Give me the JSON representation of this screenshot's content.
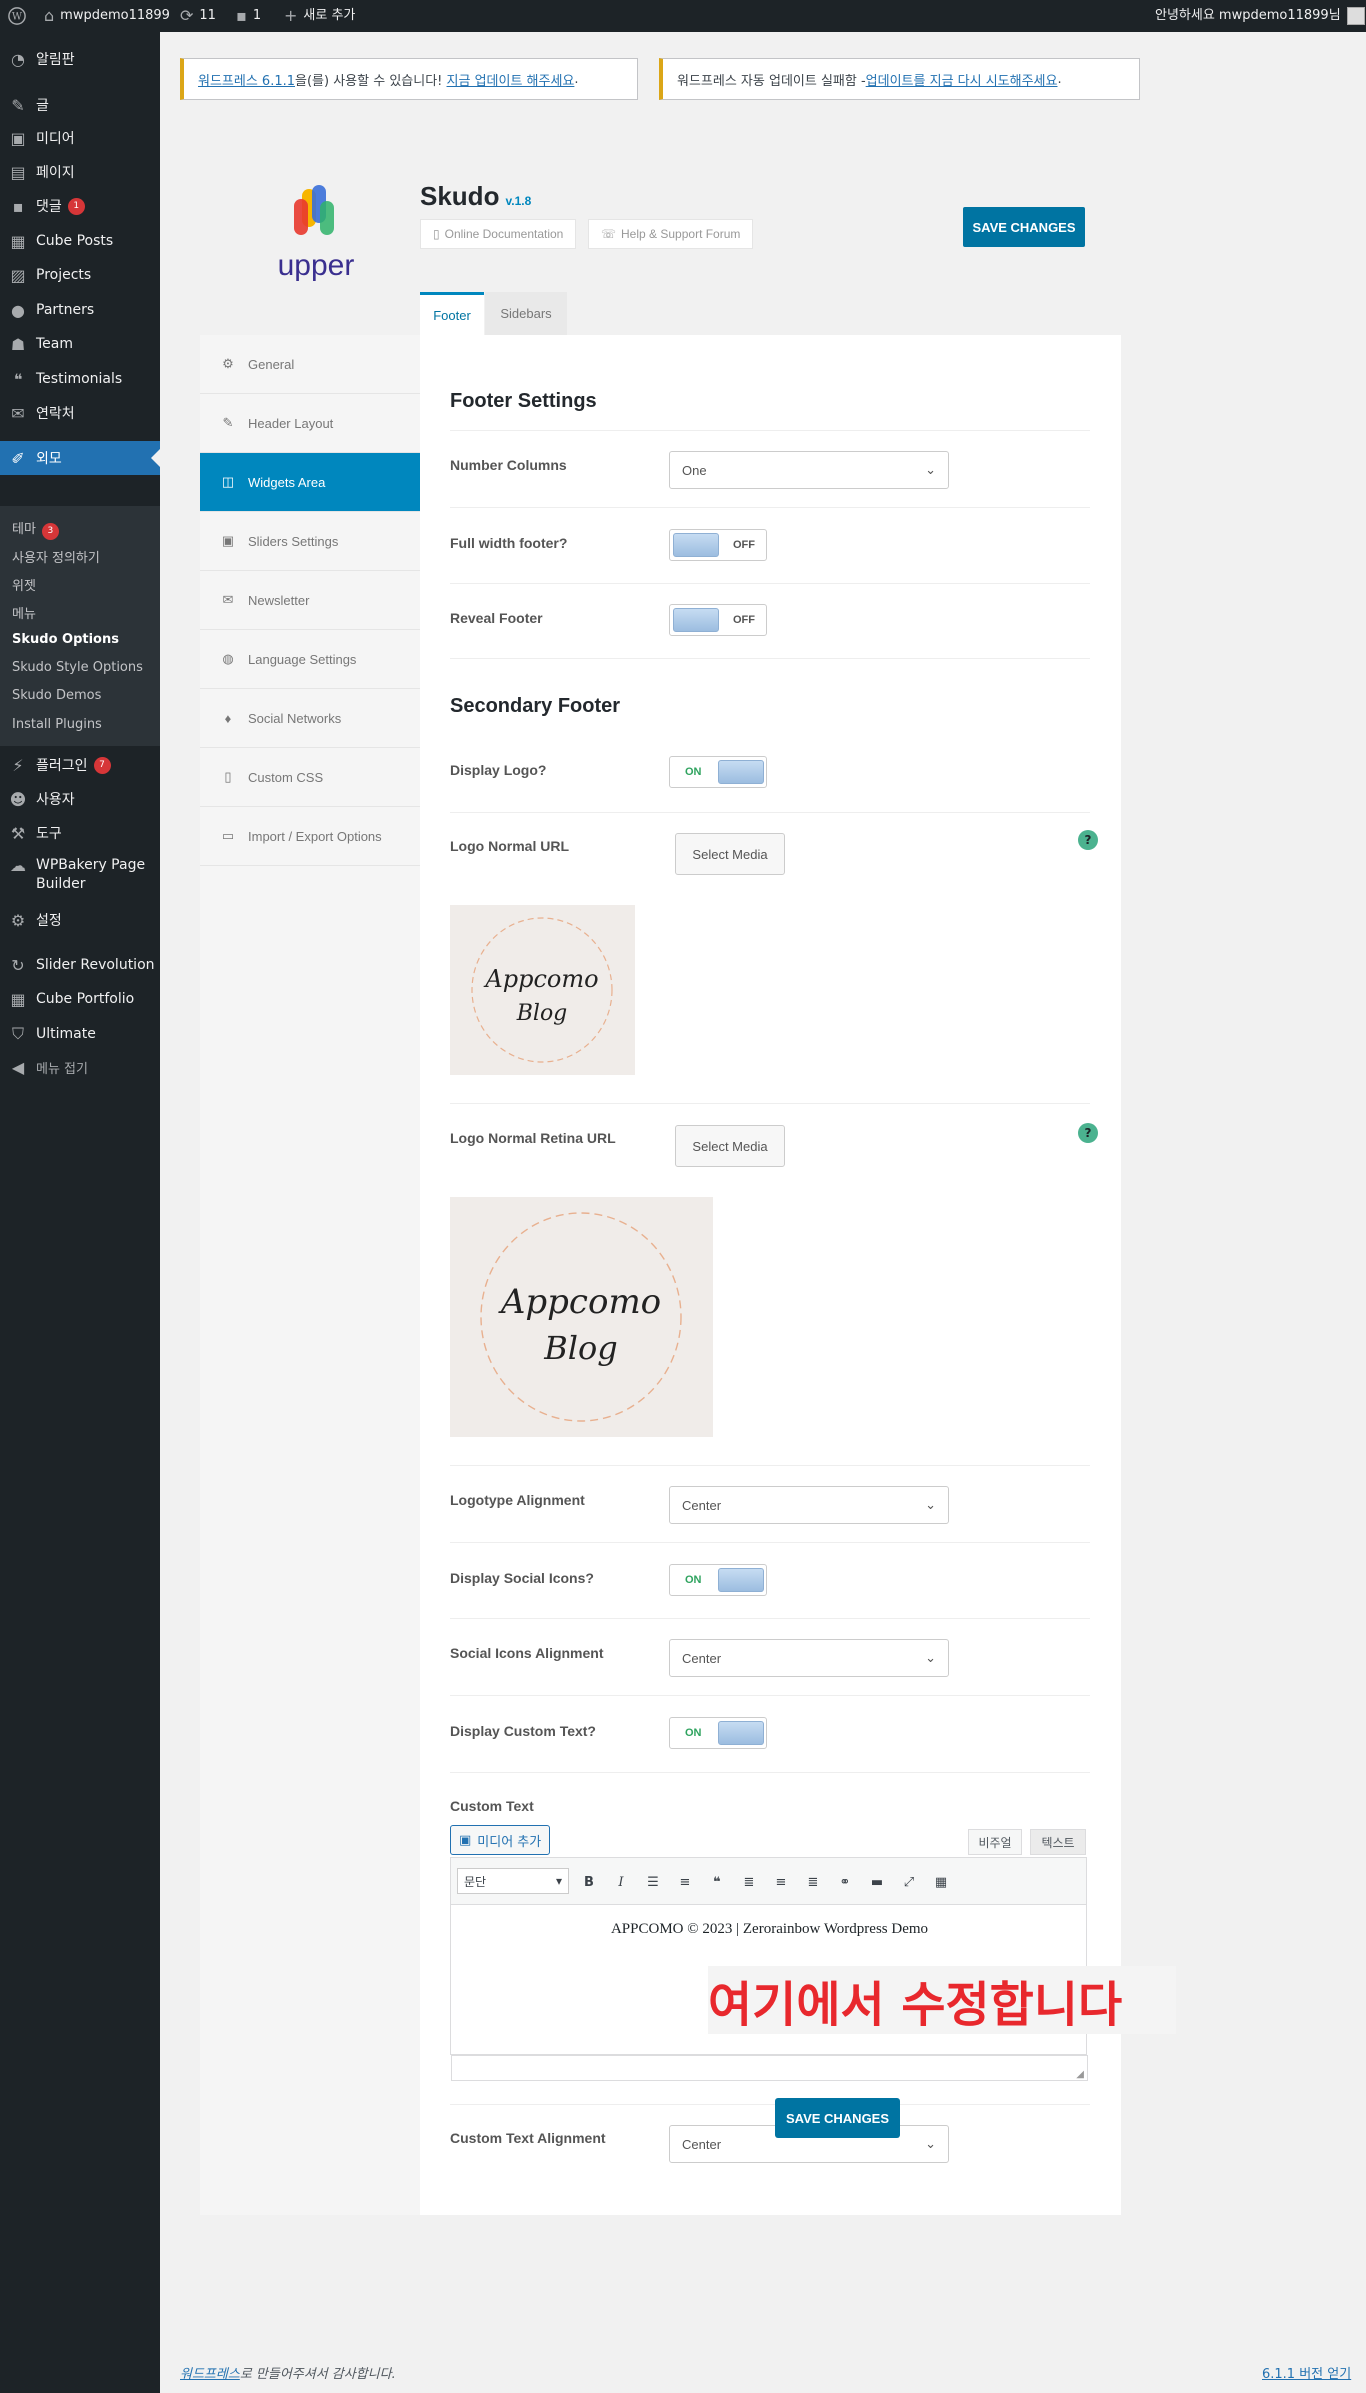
{
  "adminbar": {
    "site_name": "mwpdemo11899",
    "updates_count": "11",
    "comments_count": "1",
    "new_label": "새로 추가",
    "greeting": "안녕하세요 mwpdemo11899님"
  },
  "sidebar": {
    "items": [
      {
        "label": "알림판",
        "icon": "dashboard-icon"
      },
      {
        "label": "글",
        "icon": "pin-icon"
      },
      {
        "label": "미디어",
        "icon": "media-icon"
      },
      {
        "label": "페이지",
        "icon": "page-icon"
      },
      {
        "label": "댓글",
        "icon": "comment-icon",
        "badge": "1"
      },
      {
        "label": "Cube Posts",
        "icon": "cube-icon"
      },
      {
        "label": "Projects",
        "icon": "projects-icon"
      },
      {
        "label": "Partners",
        "icon": "partners-icon"
      },
      {
        "label": "Team",
        "icon": "team-icon"
      },
      {
        "label": "Testimonials",
        "icon": "testimonials-icon"
      },
      {
        "label": "연락처",
        "icon": "mail-icon"
      },
      {
        "label": "외모",
        "icon": "brush-icon"
      }
    ],
    "submenu": [
      {
        "label": "테마",
        "badge": "3"
      },
      {
        "label": "사용자 정의하기"
      },
      {
        "label": "위젯"
      },
      {
        "label": "메뉴"
      },
      {
        "label": "Skudo Options"
      },
      {
        "label": "Skudo Style Options"
      },
      {
        "label": "Skudo Demos"
      },
      {
        "label": "Install Plugins"
      }
    ],
    "lower_items": [
      {
        "label": "플러그인",
        "badge": "7"
      },
      {
        "label": "사용자"
      },
      {
        "label": "도구"
      },
      {
        "label": "WPBakery Page Builder"
      },
      {
        "label": "설정"
      },
      {
        "label": "Slider Revolution"
      },
      {
        "label": "Cube Portfolio"
      },
      {
        "label": "Ultimate"
      },
      {
        "label": "메뉴 접기"
      }
    ]
  },
  "notices": {
    "n1_link": "워드프레스 6.1.1",
    "n1_text": "을(를) 사용할 수 있습니다!",
    "n1_action": "지금 업데이트 해주세요",
    "n2_text": "워드프레스 자동 업데이트 실패함 - ",
    "n2_action": "업데이트를 지금 다시 시도해주세요"
  },
  "panel": {
    "logo_text": "upper",
    "title": "Skudo",
    "version": "v.1.8",
    "doc_label": "Online Documentation",
    "support_label": "Help & Support Forum",
    "save_label": "SAVE CHANGES",
    "tabs": [
      "Footer",
      "Sidebars"
    ],
    "nav": [
      "General",
      "Header Layout",
      "Widgets Area",
      "Sliders Settings",
      "Newsletter",
      "Language Settings",
      "Social Networks",
      "Custom CSS",
      "Import / Export Options"
    ]
  },
  "footer_settings": {
    "section_title": "Footer Settings",
    "number_columns_label": "Number Columns",
    "number_columns_value": "One",
    "full_width_label": "Full width footer?",
    "full_width_state": "OFF",
    "reveal_label": "Reveal Footer",
    "reveal_state": "OFF"
  },
  "secondary_footer": {
    "section_title": "Secondary Footer",
    "display_logo_label": "Display Logo?",
    "display_logo_state": "ON",
    "logo_url_label": "Logo Normal URL",
    "logo_retina_label": "Logo Normal Retina URL",
    "select_media": "Select Media",
    "logo_image_text_1": "Appcomo",
    "logo_image_text_2": "Blog",
    "logotype_align_label": "Logotype Alignment",
    "logotype_align_value": "Center",
    "social_icons_label": "Display Social Icons?",
    "social_icons_state": "ON",
    "social_align_label": "Social Icons Alignment",
    "social_align_value": "Center",
    "custom_text_toggle_label": "Display Custom Text?",
    "custom_text_toggle_state": "ON",
    "custom_text_label": "Custom Text",
    "add_media": "미디어 추가",
    "visual_tab": "비주얼",
    "text_tab": "텍스트",
    "format_select": "문단",
    "editor_content": "APPCOMO © 2023 | Zerorainbow Wordpress Demo",
    "custom_align_label": "Custom Text Alignment",
    "custom_align_value": "Center"
  },
  "overlay_annotation": "여기에서 수정합니다",
  "footer": {
    "thanks_link": "워드프레스",
    "thanks_text": "로 만들어주셔서 감사합니다.",
    "version_link": "6.1.1 버전 얻기"
  },
  "colors": {
    "accent": "#0087be",
    "save_button": "#0074a2",
    "admin_dark": "#1d2327",
    "badge_red": "#d63638",
    "annotation_red": "#e8282d"
  }
}
